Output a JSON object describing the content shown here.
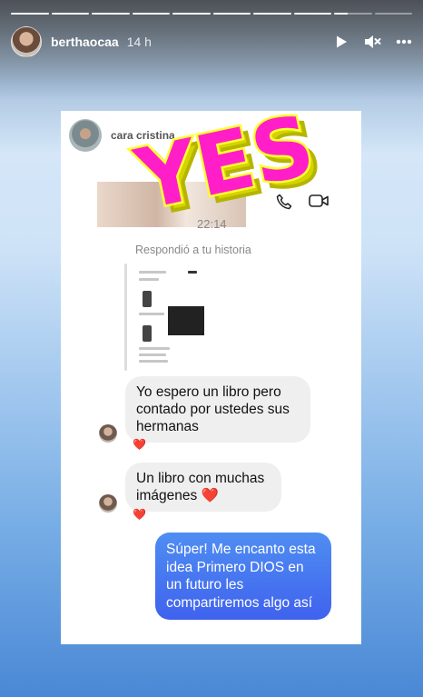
{
  "story": {
    "progress_segments": 10,
    "active_segment_index": 8,
    "active_progress": 0.35
  },
  "header": {
    "username": "berthaocaa",
    "time_ago": "14 h",
    "icons": [
      "play-icon",
      "mute-icon",
      "more-icon"
    ]
  },
  "chat": {
    "contact_name": "cara cristina",
    "call_time": "22:14",
    "reply_label": "Respondió a tu historia",
    "sticker_text": "YES",
    "messages": [
      {
        "from": "them",
        "text": "Yo espero un libro pero contado por ustedes sus hermanas",
        "reaction": "❤️"
      },
      {
        "from": "them",
        "text": "Un libro con muchas imágenes",
        "emoji": "❤️",
        "reaction": "❤️"
      },
      {
        "from": "me",
        "text": "Súper! Me encanto esta idea Primero DIOS en un futuro les compartiremos algo así"
      }
    ]
  },
  "colors": {
    "sticker_fill": "#ff1ec8",
    "sticker_outline": "#ffff33",
    "sent_bubble": "#4169ee"
  }
}
